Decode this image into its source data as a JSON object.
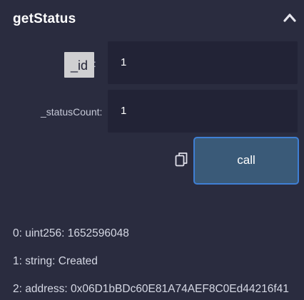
{
  "function": {
    "name": "getStatus",
    "collapse_icon": "chevron-up-icon"
  },
  "inputs": [
    {
      "label": "id:",
      "tooltip": "_id",
      "value": "1"
    },
    {
      "label": "_statusCount:",
      "value": "1"
    }
  ],
  "actions": {
    "call_label": "call",
    "copy_icon": "copy-icon"
  },
  "outputs": [
    "0: uint256: 1652596048",
    "1: string: Created",
    "2:  address: 0x06D1bBDc60E81A74AEF8C0Ed44216f41"
  ]
}
